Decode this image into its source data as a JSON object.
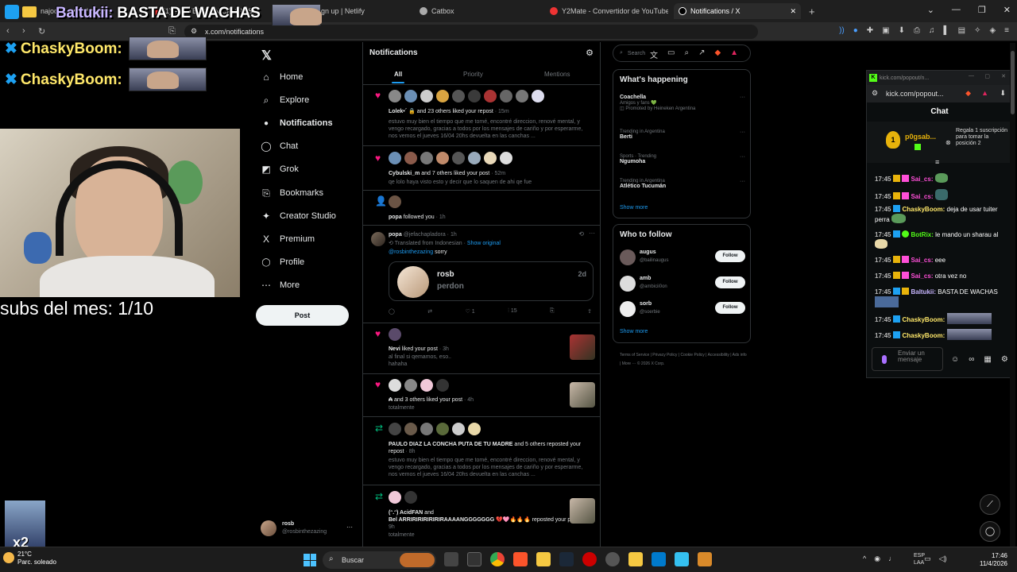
{
  "browser": {
    "tabs": [
      {
        "label": "najocina - playlist bu...",
        "active": false
      },
      {
        "label": "(1) FUSTES CON CAMPOS",
        "active": false
      },
      {
        "label": "Sign up | Netlify",
        "active": false
      },
      {
        "label": "Catbox",
        "active": false
      },
      {
        "label": "Y2Mate - Convertidor de YouTube a",
        "active": false
      },
      {
        "label": "Notifications / X",
        "active": true
      }
    ],
    "new_tab": "+",
    "url": "x.com/notifications"
  },
  "overlay": {
    "title_name": "Baltukii:",
    "title_msg": "BASTA DE WACHAS",
    "lines": [
      "ChaskyBoom:",
      "ChaskyBoom:"
    ],
    "subs": "subs del mes: 1/10",
    "mini_badge": "x2"
  },
  "x_nav": {
    "items": [
      {
        "label": "Home",
        "icon": "⌂"
      },
      {
        "label": "Explore",
        "icon": "⌕"
      },
      {
        "label": "Notifications",
        "icon": "🔔"
      },
      {
        "label": "Chat",
        "icon": "◯"
      },
      {
        "label": "Grok",
        "icon": "◩"
      },
      {
        "label": "Bookmarks",
        "icon": "⎘"
      },
      {
        "label": "Creator Studio",
        "icon": "✦"
      },
      {
        "label": "Premium",
        "icon": "X"
      },
      {
        "label": "Profile",
        "icon": "👤"
      },
      {
        "label": "More",
        "icon": "⋯"
      }
    ],
    "post_label": "Post",
    "account_name": "rosb",
    "account_handle": "@rosbinthezazing"
  },
  "feed": {
    "title": "Notifications",
    "tabs": [
      "All",
      "Priority",
      "Mentions"
    ],
    "n1": {
      "who": "Lolek•´ 🔒",
      "rest": "and 23 others liked your repost",
      "time": "· 15m",
      "sub": "estuvo muy bien el tiempo que me tomé, encontré direccion, renové mental, y vengo recargado, gracias a todos por los mensajes de cariño y por esperarme, nos vemos el jueves 16/04 20hs devuelta en las canchas ..."
    },
    "n2": {
      "who": "Cybulski_m",
      "rest": "and 7 others liked your post",
      "time": "· 52m",
      "sub": "qe lolo haya visto esto y decir que lo saquen de ahi qe fue"
    },
    "n3": {
      "who": "popa",
      "rest": "followed you",
      "time": "· 1h"
    },
    "popa_post": {
      "name": "popa",
      "handle": "@jefachapladora · 1h",
      "translated": "Translated from Indonesian",
      "show_original": "Show original",
      "mention": "@rosbinthezazing",
      "text": "sorry",
      "quote_name": "rosb",
      "quote_text": "perdon",
      "quote_date": "2d",
      "likes": "1",
      "views": "15"
    },
    "n4": {
      "who": "Nevi",
      "rest": "liked your post",
      "time": "· 3h",
      "sub1": "al final si qemamos, eso..",
      "sub2": "hahaha"
    },
    "n5": {
      "who": "₳",
      "rest": "and 3 others liked your post",
      "time": "· 4h",
      "sub": "totalmente"
    },
    "n6": {
      "who": "PAULO DIAZ LA CONCHA PUTA DE TU MADRE",
      "rest": "and 5 others reposted your repost",
      "time": "· 8h",
      "sub": "estuvo muy bien el tiempo que me tomé, encontré direccion, renové mental, y vengo recargado, gracias a todos por los mensajes de cariño y por esperarme, nos vemos el jueves 16/04 20hs devuelta en las canchas ..."
    },
    "n7": {
      "who": "(ᵔ.ᵔ) AcidFAN",
      "rest": "and",
      "who2": "Bel ARRIRIRIRIRIRIRAAAANGGGGGGG 💔🩷🔥🔥🔥",
      "rest2": "reposted your post",
      "time": "· 9h",
      "sub": "totalmente"
    }
  },
  "right": {
    "search_placeholder": "Search",
    "happening_title": "What's happening",
    "trends": [
      {
        "meta": "",
        "name": "Coachella",
        "extra": "Amigos y fans 💚",
        "promo": "Promoted by Heineken Argentina"
      },
      {
        "meta": "Trending in Argentina",
        "name": "Berti"
      },
      {
        "meta": "Sports · Trending",
        "name": "Ngumoha"
      },
      {
        "meta": "Trending in Argentina",
        "name": "Atlético Tucumán"
      }
    ],
    "show_more": "Show more",
    "wtf_title": "Who to follow",
    "follow": [
      {
        "name": "augus",
        "handle": "@bailinaugus"
      },
      {
        "name": "amb",
        "handle": "@ambicii0on"
      },
      {
        "name": "sorb",
        "handle": "@soerbie"
      }
    ],
    "follow_label": "Follow",
    "footer": "Terms of Service  |  Privacy Policy  |  Cookie Policy  |  Accessibility  |  Ads info  |  More ···  © 2026 X Corp."
  },
  "kick": {
    "window_title": "kick.com/popout/n...",
    "url": "kick.com/popout...",
    "chat_title": "Chat",
    "sub_user": "p0gsab...",
    "sub_count": "1",
    "gift_text": "Regala 1 suscripción para tomar la posición 2",
    "messages": [
      {
        "time": "17:45",
        "user": "Sai_cs:",
        "text": "",
        "color": "#ff4fd8"
      },
      {
        "time": "17:45",
        "user": "Sai_cs:",
        "text": "",
        "color": "#ff4fd8"
      },
      {
        "time": "17:45",
        "user": "ChaskyBoom:",
        "text": "deja de usar tuiter perra",
        "color": "#ffe86a"
      },
      {
        "time": "17:45",
        "user": "BotRix:",
        "text": "le mando un sharau al",
        "color": "#53fc18"
      },
      {
        "time": "17:45",
        "user": "Sai_cs:",
        "text": "eee",
        "color": "#ff4fd8"
      },
      {
        "time": "17:45",
        "user": "Sai_cs:",
        "text": "otra vez no",
        "color": "#ff4fd8"
      },
      {
        "time": "17:45",
        "user": "Baltukii:",
        "text": "BASTA DE WACHAS",
        "color": "#c8b6ff"
      },
      {
        "time": "17:45",
        "user": "ChaskyBoom:",
        "text": "",
        "color": "#ffe86a"
      },
      {
        "time": "17:45",
        "user": "ChaskyBoom:",
        "text": "",
        "color": "#ffe86a"
      }
    ],
    "input_placeholder": "Enviar un mensaje"
  },
  "taskbar": {
    "temp": "21°C",
    "weather": "Parc. soleado",
    "search": "Buscar",
    "lang1": "ESP",
    "lang2": "LAA",
    "time": "17:46",
    "date": "11/4/2026"
  }
}
